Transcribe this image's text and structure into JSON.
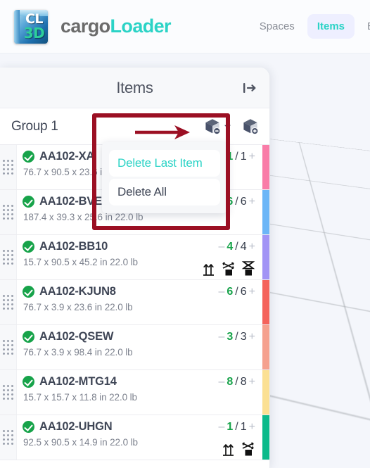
{
  "app": {
    "brand_part1": "cargo",
    "brand_part2": "Loader",
    "logo_top_text": "CL",
    "logo_bottom_text": "3D"
  },
  "nav": {
    "items": [
      {
        "label": "Spaces",
        "active": false
      },
      {
        "label": "Items",
        "active": true
      },
      {
        "label": "B",
        "active": false
      }
    ]
  },
  "panel": {
    "title": "Items",
    "collapse_icon": "collapse-panel-right-icon",
    "group": {
      "name": "Group 1",
      "remove_icon": "box-minus-icon",
      "dropdown_icon": "chevron-down-icon",
      "add_icon": "box-plus-icon"
    }
  },
  "menu": {
    "items": [
      {
        "label": "Delete Last Item",
        "state": "highlight"
      },
      {
        "label": "Delete All",
        "state": "plain"
      }
    ]
  },
  "items": [
    {
      "name": "AA102-XA",
      "dims": "76.7 x 90.5 x 23.6 in 22.0 lb",
      "current": "1",
      "total": "1",
      "color": "#f97ca8",
      "handling": []
    },
    {
      "name": "AA102-BVE",
      "dims": "187.4 x 39.3 x 25.6 in 22.0 lb",
      "current": "6",
      "total": "6",
      "color": "#6cb6f7",
      "handling": []
    },
    {
      "name": "AA102-BB10",
      "dims": "15.7 x 90.5 x 45.2 in 22.0 lb",
      "current": "4",
      "total": "4",
      "color": "#a294f5",
      "handling": [
        "this-side-up-icon",
        "no-tilt-icon",
        "do-not-stack-icon"
      ]
    },
    {
      "name": "AA102-KJUN8",
      "dims": "76.7 x 3.9 x 23.6 in 22.0 lb",
      "current": "6",
      "total": "6",
      "color": "#f4635c",
      "handling": []
    },
    {
      "name": "AA102-QSEW",
      "dims": "76.7 x 3.9 x 98.4 in 22.0 lb",
      "current": "3",
      "total": "3",
      "color": "#f5a18f",
      "handling": []
    },
    {
      "name": "AA102-MTG14",
      "dims": "15.7 x 15.7 x 11.8 in 22.0 lb",
      "current": "8",
      "total": "8",
      "color": "#fbe093",
      "handling": []
    },
    {
      "name": "AA102-UHGN",
      "dims": "92.5 x 90.5 x 14.9 in 22.0 lb",
      "current": "1",
      "total": "1",
      "color": "#0cba8b",
      "handling": [
        "this-side-up-icon",
        "no-tilt-icon"
      ]
    }
  ],
  "qty_controls": {
    "minus": "–",
    "plus": "+",
    "separator": "/"
  },
  "annotation": {
    "color": "#9b0f23",
    "arrow_icon": "pointer-arrow-right-icon",
    "box_icon": "highlight-rectangle"
  },
  "colors": {
    "accent_teal": "#2bd3c6",
    "nav_active_bg": "#eeefff",
    "check_green": "#17a34a",
    "text_dark": "#3f4656",
    "text_muted": "#7d828e",
    "annotation_red": "#9b0f23"
  }
}
